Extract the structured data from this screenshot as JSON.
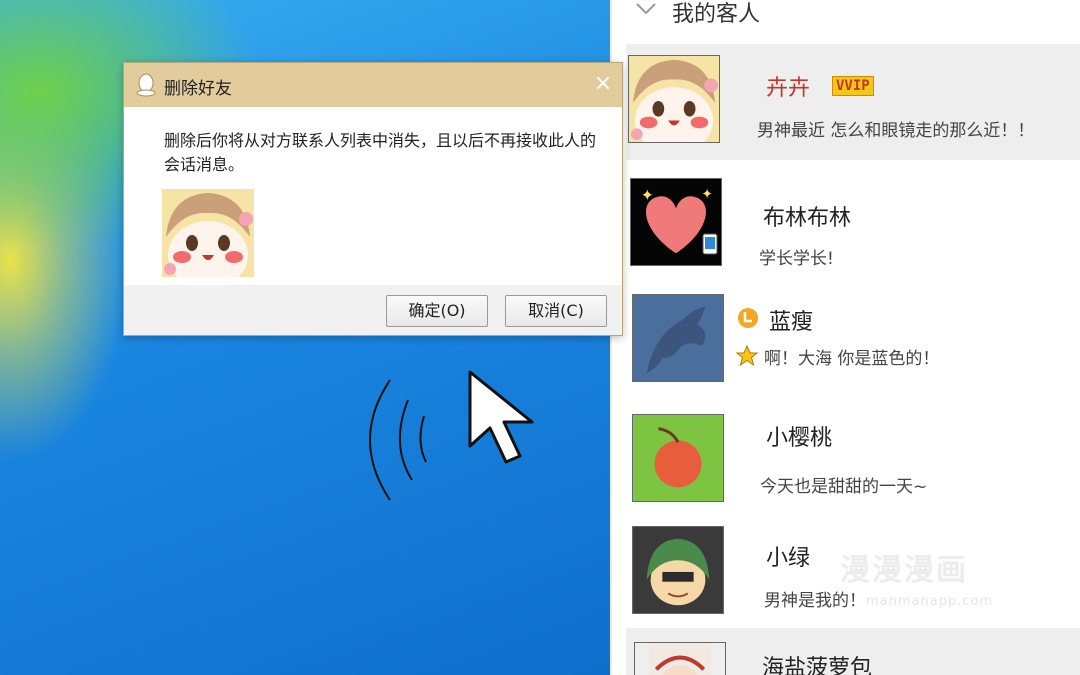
{
  "dialog": {
    "title": "删除好友",
    "message": "删除后你将从对方联系人列表中消失，且以后不再接收此人的会话消息。",
    "confirm_label": "确定(O)",
    "cancel_label": "取消(C)",
    "close_icon": "×"
  },
  "contacts_panel": {
    "group_title": "我的客人",
    "contacts": [
      {
        "name": "卉卉",
        "badge": "VVIP",
        "signature": "男神最近 怎么和眼镜走的那么近！！",
        "selected": true
      },
      {
        "name": "布林布林",
        "signature": "学长学长!",
        "status_icon": "mobile-phone-icon"
      },
      {
        "name": "蓝瘦",
        "signature": "啊！大海 你是蓝色的！",
        "status_icon": "level-crown-icon",
        "sig_icon": "star-badge-icon"
      },
      {
        "name": "小樱桃",
        "signature": "今天也是甜甜的一天~"
      },
      {
        "name": "小绿",
        "signature": "男神是我的！"
      },
      {
        "name": "海盐菠萝包",
        "signature": ""
      }
    ]
  },
  "watermark": {
    "text": "漫漫漫画",
    "url": "manmanapp.com"
  },
  "colors": {
    "dialog_title_bg": "#e3cc9c",
    "desktop_blue": "#1a86e0",
    "vip_gold": "#f5c518",
    "name_red": "#c0392b"
  }
}
